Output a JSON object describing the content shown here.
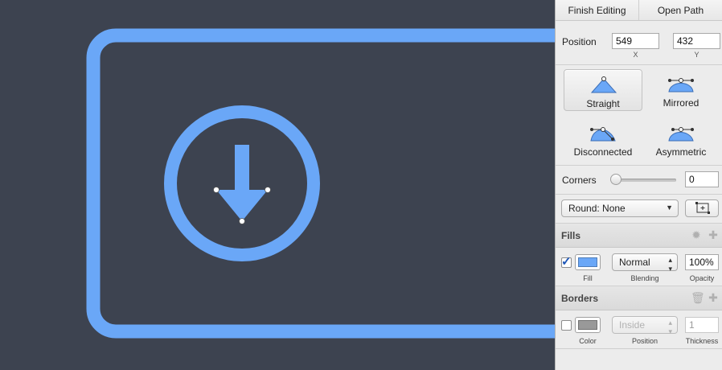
{
  "toolbar": {
    "finish_editing": "Finish Editing",
    "open_path": "Open Path"
  },
  "position": {
    "label": "Position",
    "x_value": "549",
    "y_value": "432",
    "x_caption": "X",
    "y_caption": "Y"
  },
  "point_types": [
    {
      "label": "Straight",
      "selected": true
    },
    {
      "label": "Mirrored",
      "selected": false
    },
    {
      "label": "Disconnected",
      "selected": false
    },
    {
      "label": "Asymmetric",
      "selected": false
    }
  ],
  "corners": {
    "label": "Corners",
    "value": "0",
    "slider_value": 0
  },
  "round": {
    "selected": "Round: None"
  },
  "fills": {
    "title": "Fills",
    "row": {
      "checked": true,
      "color": "#6aa7f7",
      "color_caption": "Fill",
      "blending": "Normal",
      "blending_caption": "Blending",
      "opacity": "100%",
      "opacity_caption": "Opacity"
    }
  },
  "borders": {
    "title": "Borders",
    "row": {
      "checked": false,
      "color": "#999999",
      "color_caption": "Color",
      "position": "Inside",
      "position_caption": "Position",
      "thickness": "1",
      "thickness_caption": "Thickness"
    }
  },
  "canvas": {
    "background": "#3d4350",
    "shape_color": "#6aa7f7",
    "icon": "download-arrow-icon"
  }
}
